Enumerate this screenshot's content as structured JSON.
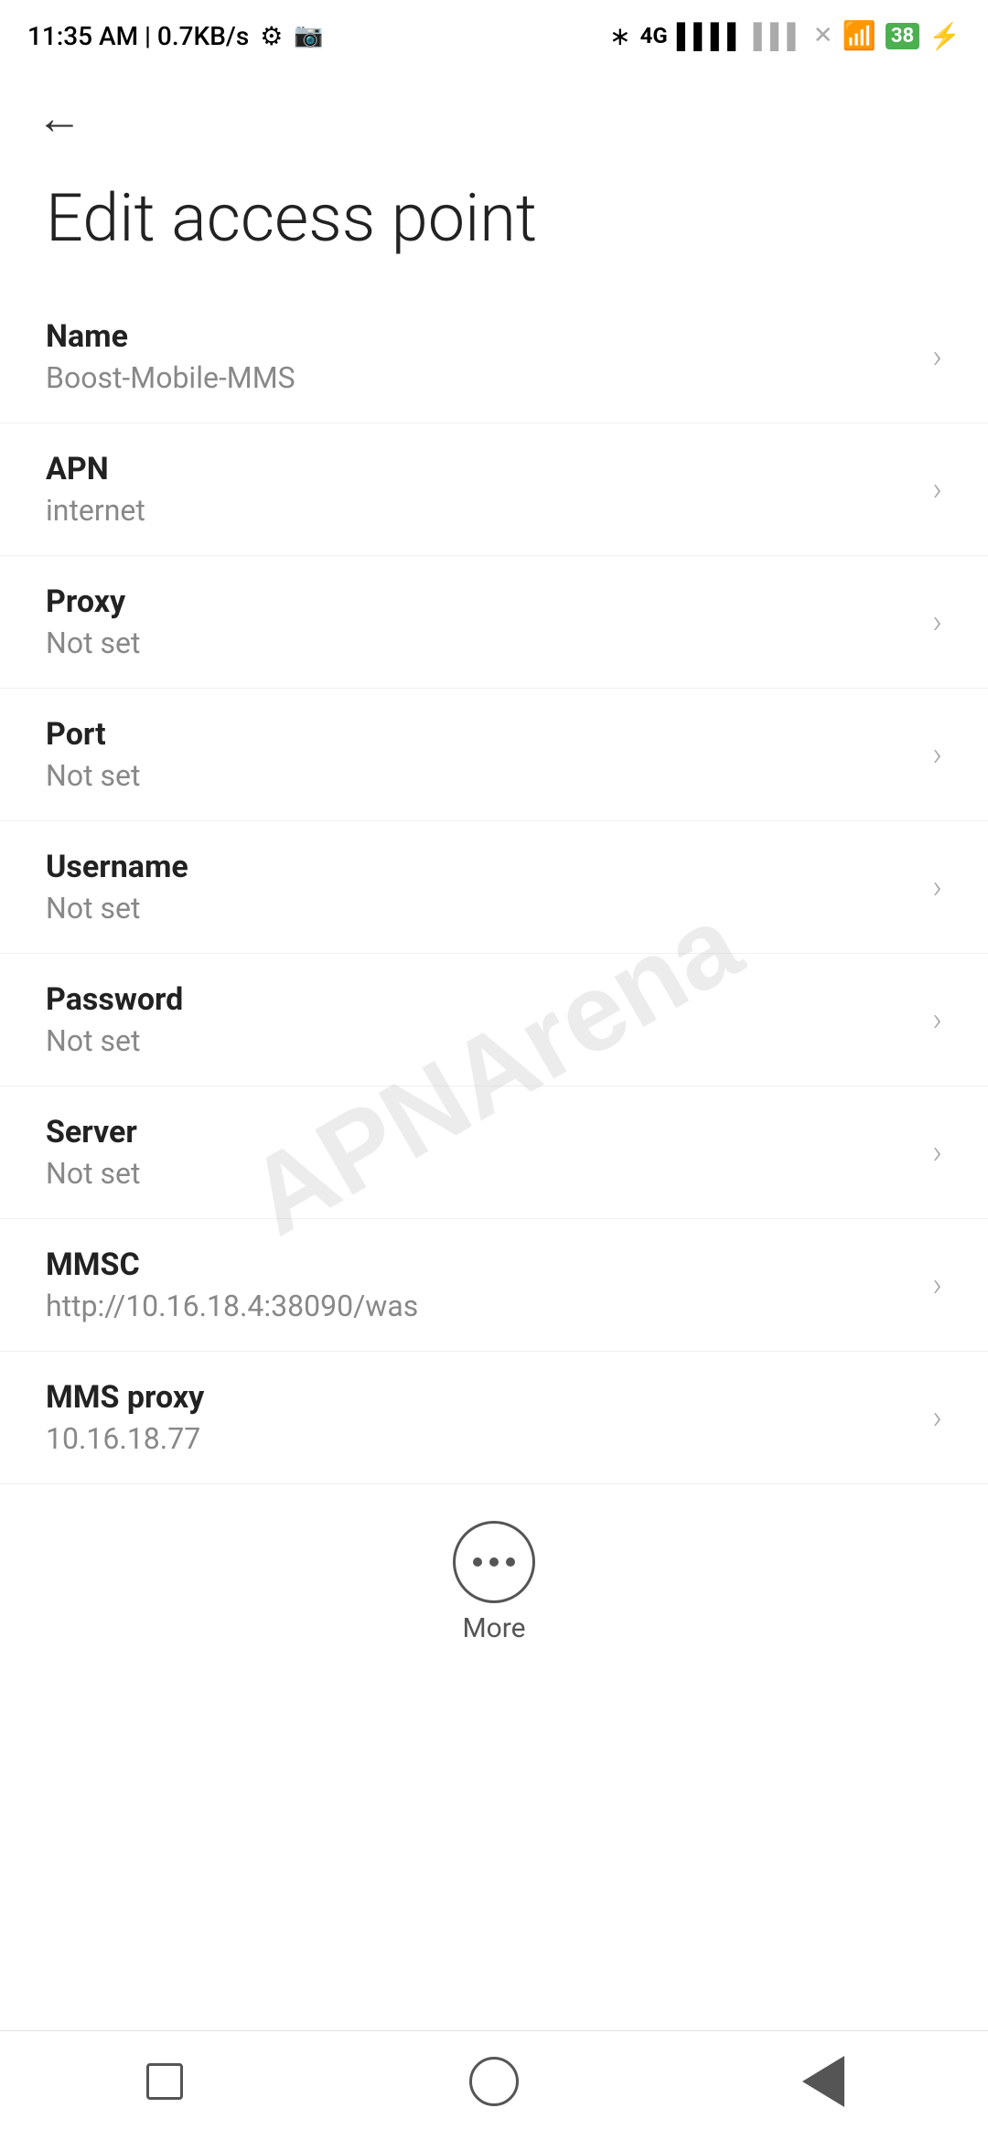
{
  "status_bar": {
    "time": "11:35 AM | 0.7KB/s",
    "icons": [
      "gear-icon",
      "video-icon",
      "bluetooth-icon",
      "signal-4g-icon",
      "signal-bars-icon",
      "signal-bars2-icon",
      "x-signal-icon",
      "wifi-icon",
      "battery-icon",
      "bolt-icon"
    ],
    "battery_level": "38"
  },
  "header": {
    "back_label": "←",
    "title": "Edit access point"
  },
  "settings_items": [
    {
      "label": "Name",
      "value": "Boost-Mobile-MMS"
    },
    {
      "label": "APN",
      "value": "internet"
    },
    {
      "label": "Proxy",
      "value": "Not set"
    },
    {
      "label": "Port",
      "value": "Not set"
    },
    {
      "label": "Username",
      "value": "Not set"
    },
    {
      "label": "Password",
      "value": "Not set"
    },
    {
      "label": "Server",
      "value": "Not set"
    },
    {
      "label": "MMSC",
      "value": "http://10.16.18.4:38090/was"
    },
    {
      "label": "MMS proxy",
      "value": "10.16.18.77"
    }
  ],
  "more_button": {
    "label": "More"
  },
  "watermark": {
    "text": "APNArena"
  },
  "bottom_nav": {
    "items": [
      "square",
      "circle",
      "triangle"
    ]
  }
}
